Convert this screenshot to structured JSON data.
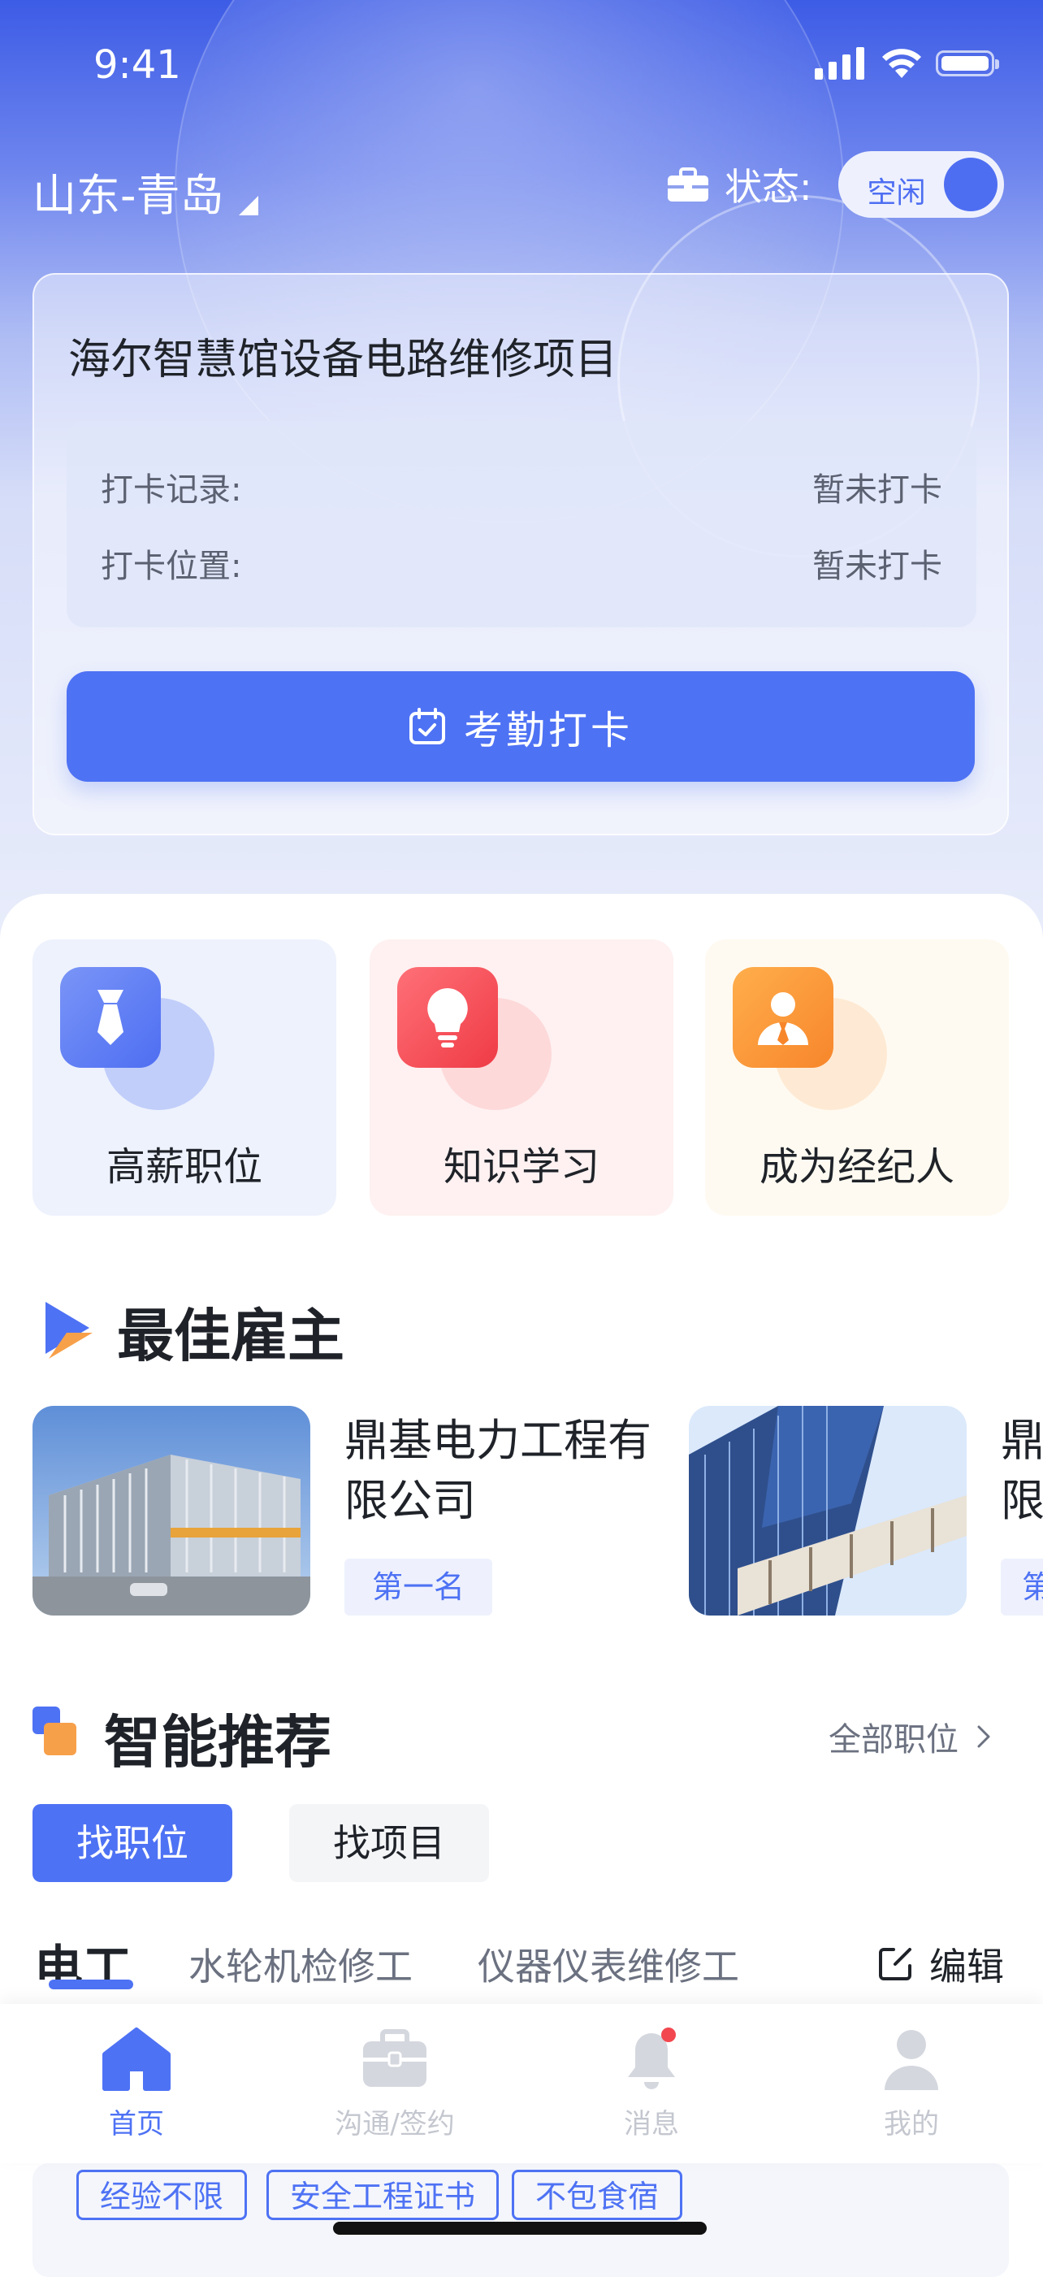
{
  "status_bar": {
    "time": "9:41"
  },
  "header": {
    "location": "山东-青岛",
    "status_label": "状态:",
    "status_toggle": "空闲"
  },
  "attendance_card": {
    "project_title": "海尔智慧馆设备电路维修项目",
    "rows": [
      {
        "label": "打卡记录:",
        "value": "暂未打卡"
      },
      {
        "label": "打卡位置:",
        "value": "暂未打卡"
      }
    ],
    "button_label": "考勤打卡"
  },
  "quick_tiles": [
    {
      "label": "高薪职位",
      "icon": "tie-icon",
      "color": "#5b7cf5"
    },
    {
      "label": "知识学习",
      "icon": "lightbulb-icon",
      "color": "#f2474f"
    },
    {
      "label": "成为经纪人",
      "icon": "agent-icon",
      "color": "#f7922e"
    }
  ],
  "best_employers": {
    "title": "最佳雇主",
    "items": [
      {
        "name_line1": "鼎基电力工程有",
        "name_line2": "限公司",
        "rank": "第一名"
      },
      {
        "name_line1": "鼎",
        "name_line2": "限",
        "rank": "第"
      }
    ]
  },
  "recommend": {
    "title": "智能推荐",
    "all_jobs": "全部职位",
    "pills": [
      "找职位",
      "找项目"
    ],
    "categories": [
      "电工",
      "水轮机检修工",
      "仪器仪表维修工"
    ],
    "edit_label": "编辑",
    "tags": [
      "经验不限",
      "安全工程证书",
      "不包食宿"
    ]
  },
  "tabbar": {
    "items": [
      {
        "label": "首页",
        "icon": "home-icon",
        "active": true
      },
      {
        "label": "沟通/签约",
        "icon": "briefcase-icon",
        "active": false
      },
      {
        "label": "消息",
        "icon": "bell-icon",
        "active": false
      },
      {
        "label": "我的",
        "icon": "user-icon",
        "active": false
      }
    ]
  },
  "colors": {
    "primary": "#4e72f4",
    "notification_dot": "#f2474f"
  }
}
